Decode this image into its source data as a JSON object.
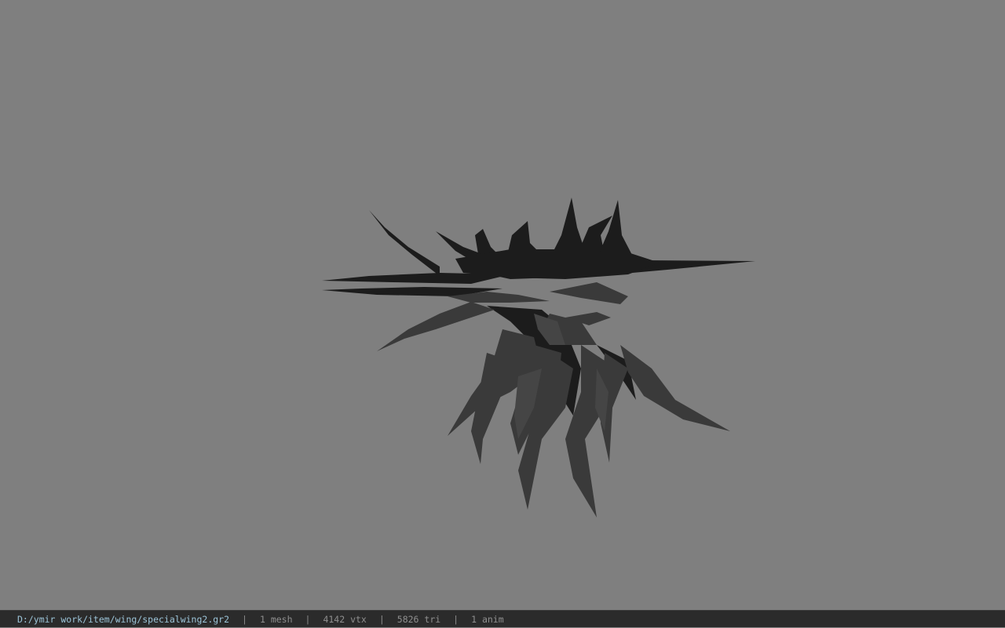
{
  "viewer": {
    "background_color": "#7f7f7f",
    "model_icon": "spiky-wing-model"
  },
  "status": {
    "file_path": "D:/ymir work/item/wing/specialwing2.gr2",
    "separator": "|",
    "mesh_count": "1 mesh",
    "vertex_count": "4142 vtx",
    "triangle_count": "5826 tri",
    "anim_count": "1 anim",
    "path_color": "#9cc4d8",
    "text_color": "#8f8f8f"
  }
}
